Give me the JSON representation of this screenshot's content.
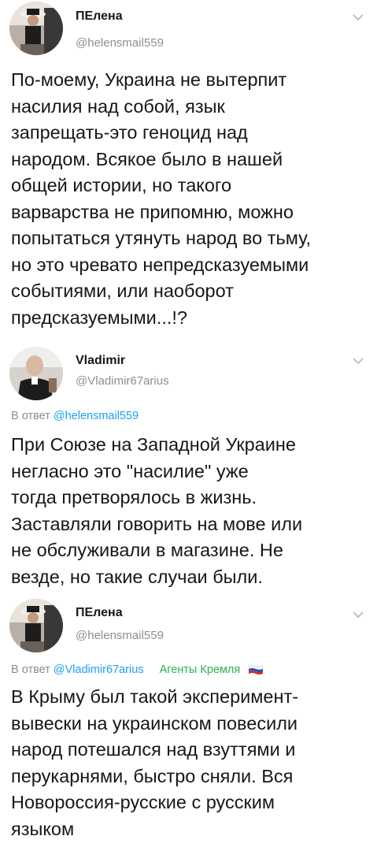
{
  "tweets": [
    {
      "name": "ПЕлена",
      "handle": "@helensmail559",
      "text": "По-моему, Украина не вытерпит\nнасилия над собой, язык\nзапрещать-это геноцид над\nнародом. Всякое было в нашей\nобщей истории, но такого\nварварства не припомню, можно\nпопытаться утянуть народ во тьму,\nно это чревато непредсказуемыми\nсобытиями, или наоборот\nпредсказуемыми...!?"
    },
    {
      "name": "Vladimir",
      "handle": "@Vladimir67arius",
      "reply_prefix": "В ответ",
      "reply_to": "@helensmail559",
      "text": "При Союзе на Западной Украине\nнегласно это \"насилие\" уже\nтогда претворялось в жизнь.\nЗаставляли говорить на мове или\nне обслуживали в магазине. Не\nвезде, но такие случаи были."
    },
    {
      "name": "ПЕлена",
      "handle": "@helensmail559",
      "reply_prefix": "В ответ",
      "reply_to": "@Vladimir67arius",
      "tag": "Агенты Кремля",
      "text": "В Крыму был такой эксперимент-\nвывески на украинском повесили\nнарод потешался над взуттями и\nперукарнями, быстро сняли. Вся\nНовороссия-русские с русским\nязыком"
    }
  ],
  "colors": {
    "link": "#1da1f2",
    "muted": "#8a8f94",
    "tag": "#2bb350",
    "text": "#14171a"
  },
  "icons": {
    "menu": "chevron-down-icon",
    "flag": "russian-flag-icon"
  }
}
